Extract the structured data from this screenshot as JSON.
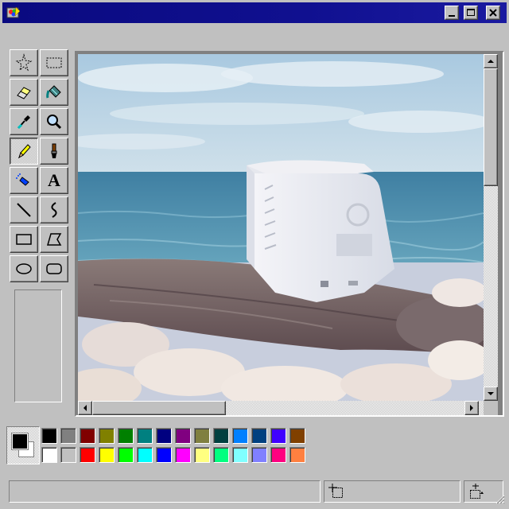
{
  "window": {
    "title": "",
    "controls": [
      "minimize",
      "maximize",
      "close"
    ]
  },
  "menu": {
    "items": [
      "",
      "",
      ""
    ]
  },
  "tools": [
    {
      "name": "free-form-select",
      "icon": "star-select-icon"
    },
    {
      "name": "select",
      "icon": "rect-select-icon"
    },
    {
      "name": "eraser",
      "icon": "eraser-icon"
    },
    {
      "name": "fill",
      "icon": "paint-bucket-icon"
    },
    {
      "name": "pick-color",
      "icon": "eyedropper-icon"
    },
    {
      "name": "magnifier",
      "icon": "magnifier-icon"
    },
    {
      "name": "pencil",
      "icon": "pencil-icon",
      "active": true
    },
    {
      "name": "brush",
      "icon": "brush-icon"
    },
    {
      "name": "airbrush",
      "icon": "airbrush-icon"
    },
    {
      "name": "text",
      "icon": "text-icon",
      "glyph": "A"
    },
    {
      "name": "line",
      "icon": "line-icon"
    },
    {
      "name": "curve",
      "icon": "curve-icon"
    },
    {
      "name": "rectangle",
      "icon": "rectangle-icon"
    },
    {
      "name": "polygon",
      "icon": "polygon-icon"
    },
    {
      "name": "ellipse",
      "icon": "ellipse-icon"
    },
    {
      "name": "rounded-rectangle",
      "icon": "rounded-rect-icon"
    }
  ],
  "palette": {
    "foreground": "#000000",
    "background": "#ffffff",
    "row1": [
      "#000000",
      "#808080",
      "#800000",
      "#808000",
      "#008000",
      "#008080",
      "#000080",
      "#800080",
      "#808040",
      "#004040",
      "#0080ff",
      "#004080",
      "#4000ff",
      "#804000"
    ],
    "row2": [
      "#ffffff",
      "#c0c0c0",
      "#ff0000",
      "#ffff00",
      "#00ff00",
      "#00ffff",
      "#0000ff",
      "#ff00ff",
      "#ffff80",
      "#00ff80",
      "#80ffff",
      "#8080ff",
      "#ff0080",
      "#ff8040"
    ]
  },
  "canvas": {
    "image": "photo-crt-monitor-on-driftwood-by-sea",
    "sky_top": "#a9c9e0",
    "sea": "#4a8aa8"
  },
  "status": {
    "text": ""
  }
}
